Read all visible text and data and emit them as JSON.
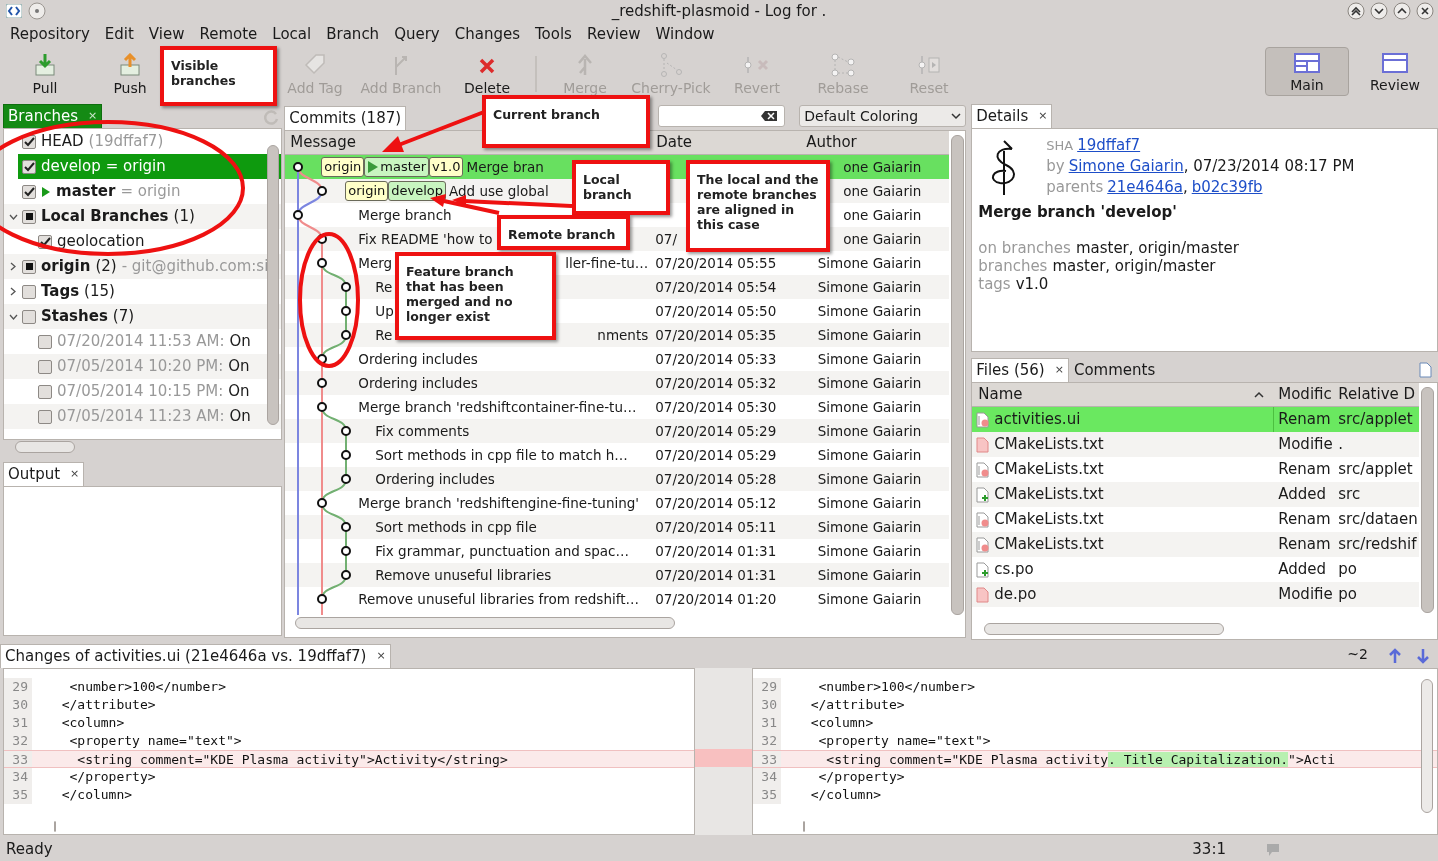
{
  "window": {
    "title": "_redshift-plasmoid - Log for ."
  },
  "menu": [
    "Repository",
    "Edit",
    "View",
    "Remote",
    "Local",
    "Branch",
    "Query",
    "Changes",
    "Tools",
    "Review",
    "Window"
  ],
  "toolbar": [
    {
      "label": "Pull",
      "disabled": false
    },
    {
      "label": "Push",
      "disabled": false
    },
    {
      "label": "Add Tag",
      "disabled": true
    },
    {
      "label": "Add Branch",
      "disabled": true
    },
    {
      "label": "Delete",
      "disabled": false
    },
    {
      "label": "Merge",
      "disabled": true
    },
    {
      "label": "Cherry-Pick",
      "disabled": true
    },
    {
      "label": "Revert",
      "disabled": true
    },
    {
      "label": "Rebase",
      "disabled": true
    },
    {
      "label": "Reset",
      "disabled": true
    }
  ],
  "views": [
    {
      "label": "Main",
      "selected": true
    },
    {
      "label": "Review",
      "selected": false
    }
  ],
  "branches_panel": {
    "tab": "Branches",
    "close": "×",
    "items": [
      {
        "kind": "ref",
        "label": "HEAD",
        "detail": "(19dffaf7)",
        "checked": true,
        "selected": false,
        "current": false
      },
      {
        "kind": "ref",
        "label": "develop",
        "detail": "= origin",
        "checked": true,
        "selected": true,
        "current": false
      },
      {
        "kind": "ref",
        "label": "master",
        "detail": "= origin",
        "checked": true,
        "selected": false,
        "current": true
      },
      {
        "kind": "group",
        "label": "Local Branches",
        "detail": "(1)",
        "checked": false,
        "partial": true,
        "selected": false,
        "expanded": true,
        "children": [
          {
            "kind": "ref",
            "label": "geolocation",
            "checked": true,
            "selected": false,
            "current": false
          }
        ]
      },
      {
        "kind": "group",
        "label": "origin",
        "detail": "(2)",
        "extra": "- git@github.com:si",
        "checked": false,
        "partial": true,
        "selected": false,
        "expanded": false
      },
      {
        "kind": "group",
        "label": "Tags",
        "detail": "(15)",
        "checked": false,
        "partial": false,
        "selected": false,
        "expanded": false
      },
      {
        "kind": "group",
        "label": "Stashes",
        "detail": "(7)",
        "checked": false,
        "partial": false,
        "selected": false,
        "expanded": true,
        "children": [
          {
            "kind": "stash",
            "label": "07/20/2014 11:53 AM:",
            "detail": "On",
            "checked": false,
            "selected": false
          },
          {
            "kind": "stash",
            "label": "07/05/2014 10:20 PM:",
            "detail": "On",
            "checked": false,
            "selected": false
          },
          {
            "kind": "stash",
            "label": "07/05/2014 10:15 PM:",
            "detail": "On",
            "checked": false,
            "selected": false
          },
          {
            "kind": "stash",
            "label": "07/05/2014 11:23 AM:",
            "detail": "On",
            "checked": false,
            "selected": false
          }
        ]
      }
    ]
  },
  "output_panel": {
    "tab": "Output",
    "close": "×"
  },
  "commits_panel": {
    "tab": "Commits (187)",
    "coloring": "Default Coloring",
    "columns": [
      "Message",
      "Date",
      "Author"
    ],
    "rows": [
      {
        "kind": "trunk",
        "selected": true,
        "refs": [
          {
            "label": "origin",
            "kind": "remote"
          },
          {
            "label": "master",
            "kind": "local",
            "current": true
          },
          {
            "label": "v1.0",
            "kind": "tag"
          }
        ],
        "message": "Merge bran",
        "author": "one Gaiarin"
      },
      {
        "kind": "main",
        "selected": false,
        "refs": [
          {
            "label": "origin",
            "kind": "remote"
          },
          {
            "label": "develop",
            "kind": "local",
            "current": false
          }
        ],
        "message": "Add use global",
        "author": "one Gaiarin"
      },
      {
        "kind": "trunk",
        "selected": false,
        "message": "Merge branch",
        "author": "one Gaiarin"
      },
      {
        "kind": "main",
        "selected": false,
        "message": "Fix README 'how to",
        "date": "07/",
        "author": "one Gaiarin"
      },
      {
        "kind": "main",
        "selected": false,
        "message": "Merg",
        "message_tail": "ller-fine-tu…",
        "date": "07/20/2014 05:55",
        "author": "Simone Gaiarin"
      },
      {
        "kind": "feature",
        "selected": false,
        "message": "Re",
        "date": "07/20/2014 05:54",
        "author": "Simone Gaiarin"
      },
      {
        "kind": "feature",
        "selected": false,
        "message": "Up",
        "date": "07/20/2014 05:50",
        "author": "Simone Gaiarin"
      },
      {
        "kind": "feature",
        "selected": false,
        "message": "Re",
        "message_tail": "nments",
        "date": "07/20/2014 05:35",
        "author": "Simone Gaiarin"
      },
      {
        "kind": "main",
        "selected": false,
        "message": "Ordering includes",
        "date": "07/20/2014 05:33",
        "author": "Simone Gaiarin"
      },
      {
        "kind": "main",
        "selected": false,
        "message": "Ordering includes",
        "date": "07/20/2014 05:32",
        "author": "Simone Gaiarin"
      },
      {
        "kind": "main",
        "selected": false,
        "message": "Merge branch 'redshiftcontainer-fine-tu…",
        "date": "07/20/2014 05:30",
        "author": "Simone Gaiarin"
      },
      {
        "kind": "feature",
        "selected": false,
        "message": "Fix comments",
        "date": "07/20/2014 05:29",
        "author": "Simone Gaiarin"
      },
      {
        "kind": "feature",
        "selected": false,
        "message": "Sort methods in cpp file to match h…",
        "date": "07/20/2014 05:29",
        "author": "Simone Gaiarin"
      },
      {
        "kind": "feature",
        "selected": false,
        "message": "Ordering includes",
        "date": "07/20/2014 05:28",
        "author": "Simone Gaiarin"
      },
      {
        "kind": "main",
        "selected": false,
        "message": "Merge branch 'redshiftengine-fine-tuning'",
        "date": "07/20/2014 05:12",
        "author": "Simone Gaiarin"
      },
      {
        "kind": "feature",
        "selected": false,
        "message": "Sort methods in cpp file",
        "date": "07/20/2014 05:11",
        "author": "Simone Gaiarin"
      },
      {
        "kind": "feature",
        "selected": false,
        "message": "Fix grammar, punctuation and spac…",
        "date": "07/20/2014 01:31",
        "author": "Simone Gaiarin"
      },
      {
        "kind": "feature",
        "selected": false,
        "message": "Remove unuseful libraries",
        "date": "07/20/2014 01:31",
        "author": "Simone Gaiarin"
      },
      {
        "kind": "main",
        "selected": false,
        "message": "Remove unuseful libraries from redshift…",
        "date": "07/20/2014 01:20",
        "author": "Simone Gaiarin"
      }
    ]
  },
  "details_panel": {
    "tab": "Details",
    "close": "×",
    "sha_label": "SHA",
    "sha": "19dffaf7",
    "by_label": "by",
    "author": "Simone Gaiarin",
    "date": ", 07/23/2014 08:17 PM",
    "parents_label": "parents",
    "parents": [
      {
        "sha": "21e4646a",
        "after": ","
      },
      {
        "sha": "b02c39fb"
      }
    ],
    "title": "Merge branch 'develop'",
    "info": [
      {
        "label": "on branches",
        "value": "master, origin/master"
      },
      {
        "label": "branches",
        "value": "master, origin/master"
      },
      {
        "label": "tags",
        "value": "v1.0"
      }
    ]
  },
  "files_panel": {
    "tabs": [
      {
        "label": "Files (56)",
        "close": "×",
        "selected": true
      },
      {
        "label": "Comments",
        "selected": false
      }
    ],
    "columns": [
      "Name",
      "Modific",
      "Relative D"
    ],
    "rows": [
      {
        "kind": "renamed",
        "name": "activities.ui",
        "status": "Renam",
        "path": "src/applet",
        "selected": true
      },
      {
        "kind": "modified",
        "name": "CMakeLists.txt",
        "status": "Modifie",
        "path": ".",
        "selected": false
      },
      {
        "kind": "renamed",
        "name": "CMakeLists.txt",
        "status": "Renam",
        "path": "src/applet",
        "selected": false
      },
      {
        "kind": "added",
        "name": "CMakeLists.txt",
        "status": "Added",
        "path": "src",
        "selected": false
      },
      {
        "kind": "renamed",
        "name": "CMakeLists.txt",
        "status": "Renam",
        "path": "src/dataen",
        "selected": false
      },
      {
        "kind": "renamed",
        "name": "CMakeLists.txt",
        "status": "Renam",
        "path": "src/redshif",
        "selected": false
      },
      {
        "kind": "added",
        "name": "cs.po",
        "status": "Added",
        "path": "po",
        "selected": false
      },
      {
        "kind": "modified",
        "name": "de.po",
        "status": "Modifie",
        "path": "po",
        "selected": false
      }
    ]
  },
  "diff_panel": {
    "tab": "Changes of activities.ui (21e4646a vs. 19dffaf7)",
    "close": "×",
    "change_count": "~2",
    "left": [
      {
        "num": "29",
        "text": "   <number>100</number>",
        "changed": false
      },
      {
        "num": "30",
        "text": "  </attribute>",
        "changed": false
      },
      {
        "num": "31",
        "text": "  <column>",
        "changed": false
      },
      {
        "num": "32",
        "text": "   <property name=\"text\">",
        "changed": false
      },
      {
        "num": "33",
        "text": "    <string comment=\"KDE Plasma activity\">Activity</string>",
        "changed": true
      },
      {
        "num": "34",
        "text": "   </property>",
        "changed": false
      },
      {
        "num": "35",
        "text": "  </column>",
        "changed": false
      }
    ],
    "right": [
      {
        "num": "29",
        "text": "   <number>100</number>",
        "changed": false
      },
      {
        "num": "30",
        "text": "  </attribute>",
        "changed": false
      },
      {
        "num": "31",
        "text": "  <column>",
        "changed": false
      },
      {
        "num": "32",
        "text": "   <property name=\"text\">",
        "changed": false
      },
      {
        "num": "33",
        "text": "    <string comment=\"KDE Plasma activity",
        "added": ". Title Capitalization.",
        "rest": "\">Acti",
        "changed": true
      },
      {
        "num": "34",
        "text": "   </property>",
        "changed": false
      },
      {
        "num": "35",
        "text": "  </column>",
        "changed": false
      }
    ]
  },
  "status_bar": {
    "message": "Ready",
    "position": "33:1"
  },
  "annotations": [
    "Visible branches",
    "Current branch",
    "Local branch",
    "The local and the remote branches are aligned in this case",
    "Remote branch",
    "Feature branch that has been merged and no longer exist"
  ]
}
